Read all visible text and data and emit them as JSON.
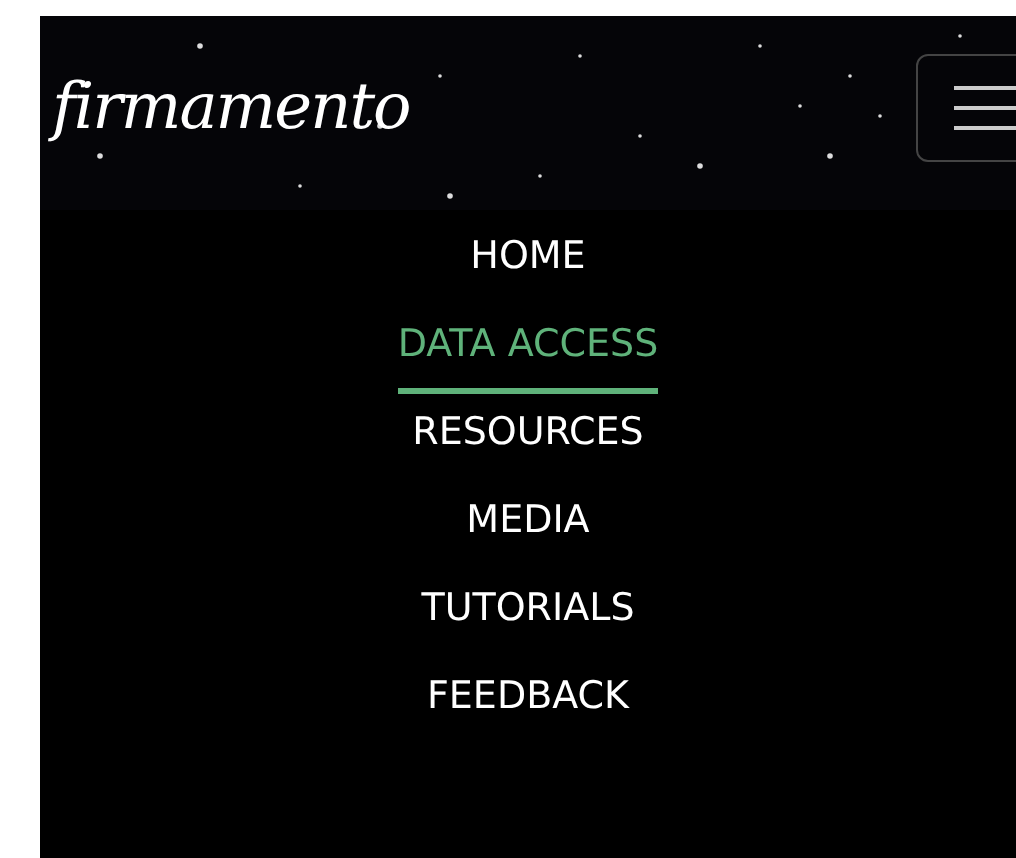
{
  "header": {
    "logo": "firmamento"
  },
  "menu": [
    {
      "label": "HOME",
      "selected": false
    },
    {
      "label": "DATA ACCESS",
      "selected": true
    },
    {
      "label": "RESOURCES",
      "selected": false
    },
    {
      "label": "MEDIA",
      "selected": false
    },
    {
      "label": "TUTORIALS",
      "selected": false
    },
    {
      "label": "FEEDBACK",
      "selected": false
    }
  ]
}
